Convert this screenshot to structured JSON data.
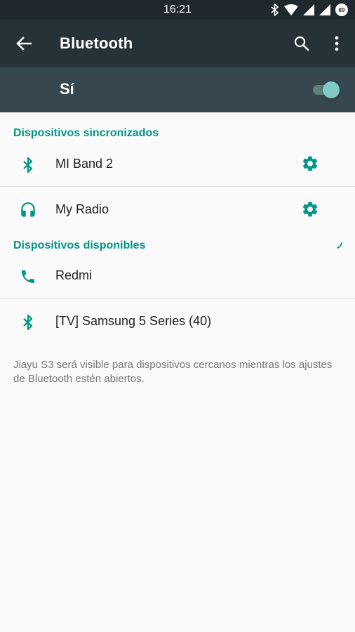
{
  "status_bar": {
    "time": "16:21",
    "battery_level": "89",
    "icons": [
      "bluetooth-icon",
      "wifi-icon",
      "signal-icon",
      "signal-icon",
      "battery-icon"
    ]
  },
  "app_bar": {
    "title": "Bluetooth",
    "back_icon": "arrow-back-icon",
    "search_icon": "search-icon",
    "more_icon": "more-vert-icon"
  },
  "master_switch": {
    "label": "Sí",
    "state": "on"
  },
  "paired": {
    "header": "Dispositivos sincronizados",
    "devices": [
      {
        "name": "MI Band 2",
        "icon": "bluetooth-icon",
        "settings_icon": "gear-icon"
      },
      {
        "name": "My Radio",
        "icon": "headset-icon",
        "settings_icon": "gear-icon"
      }
    ]
  },
  "available": {
    "header": "Dispositivos disponibles",
    "scanning_icon": "progress-spinner-icon",
    "devices": [
      {
        "name": "Redmi",
        "icon": "phone-icon"
      },
      {
        "name": "[TV] Samsung 5 Series (40)",
        "icon": "bluetooth-icon"
      }
    ]
  },
  "footer": {
    "text": "Jiayu S3 será visible para dispositivos cercanos mientras los ajustes de Bluetooth estén abiertos."
  },
  "colors": {
    "status_bar": "#1f282d",
    "app_bar": "#263238",
    "switch_bar": "#37474f",
    "accent": "#009688",
    "toggle_thumb": "#80cbc4",
    "background": "#fafafa"
  }
}
